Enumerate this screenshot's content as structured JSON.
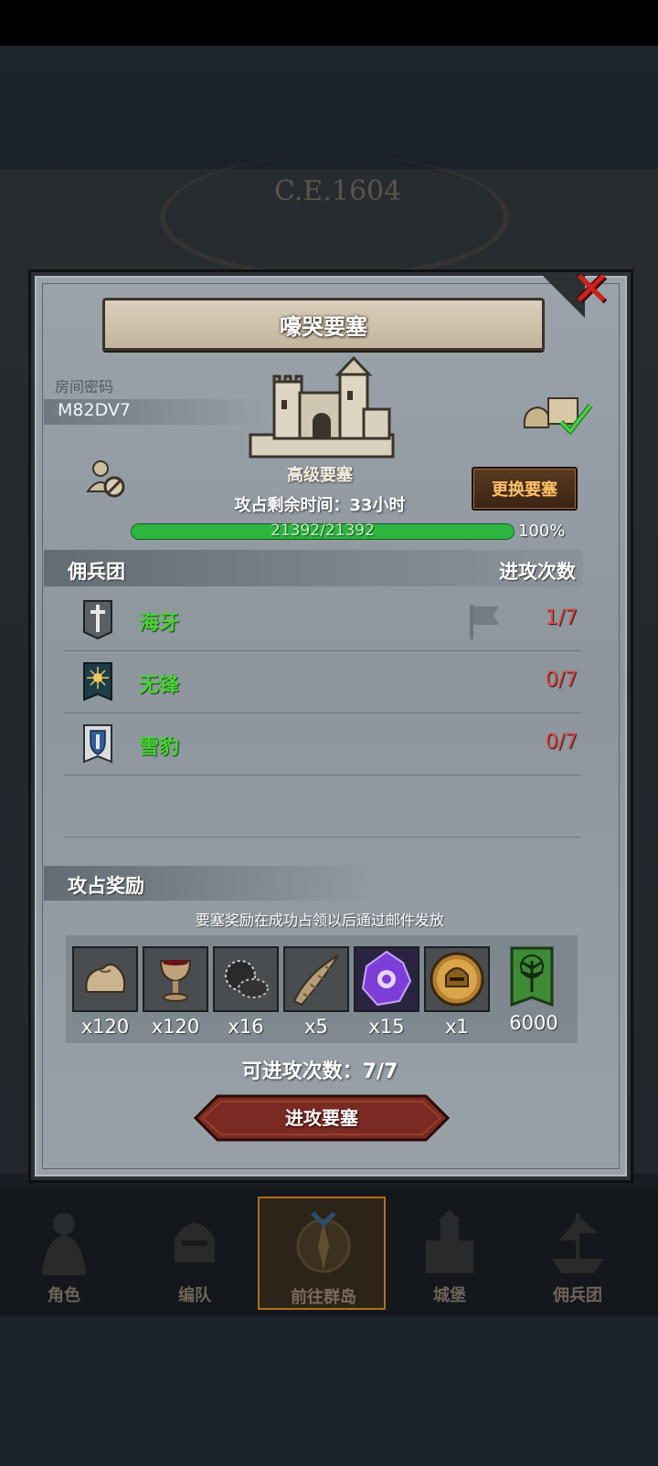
{
  "background": {
    "year_text": "C.E.1604"
  },
  "dialog": {
    "title": "嚎哭要塞",
    "room_label": "房间密码",
    "room_code": "M82DV7",
    "fortress_type": "高级要塞",
    "time_remaining": "攻占剩余时间：33小时",
    "swap_button": "更换要塞",
    "hp": {
      "text": "21392/21392",
      "percent_label": "100%",
      "fraction": 1.0
    },
    "mercenary_header": "佣兵团",
    "attack_count_header": "进攻次数",
    "mercenaries": [
      {
        "name": "海牙",
        "count": "1/7",
        "icon": "sword-banner-icon"
      },
      {
        "name": "无锋",
        "count": "0/7",
        "icon": "sun-banner-icon"
      },
      {
        "name": "雪豹",
        "count": "0/7",
        "icon": "shield-banner-icon"
      }
    ],
    "reward_title": "攻占奖励",
    "reward_note": "要塞奖励在成功占领以后通过邮件发放",
    "rewards": [
      {
        "icon": "sack-icon",
        "qty": "x120"
      },
      {
        "icon": "goblet-icon",
        "qty": "x120"
      },
      {
        "icon": "ore-icon",
        "qty": "x16"
      },
      {
        "icon": "horn-icon",
        "qty": "x5"
      },
      {
        "icon": "purple-crystal-icon",
        "qty": "x15"
      },
      {
        "icon": "helmet-medal-icon",
        "qty": "x1"
      },
      {
        "icon": "tree-banner-icon",
        "qty": "6000"
      }
    ],
    "attempts": "可进攻次数：7/7",
    "attack_button": "进攻要塞"
  },
  "nav": [
    {
      "label": "角色",
      "icon": "knight-icon",
      "active": false
    },
    {
      "label": "编队",
      "icon": "helmet-icon",
      "active": false
    },
    {
      "label": "前往群岛",
      "icon": "compass-icon",
      "active": true
    },
    {
      "label": "城堡",
      "icon": "castle-icon",
      "active": false
    },
    {
      "label": "佣兵团",
      "icon": "ship-icon",
      "active": false
    }
  ],
  "colors": {
    "accent_green": "#48d436",
    "count_red": "#e04a4a",
    "button_orange": "#ffc169",
    "close_red": "#d0201c"
  }
}
